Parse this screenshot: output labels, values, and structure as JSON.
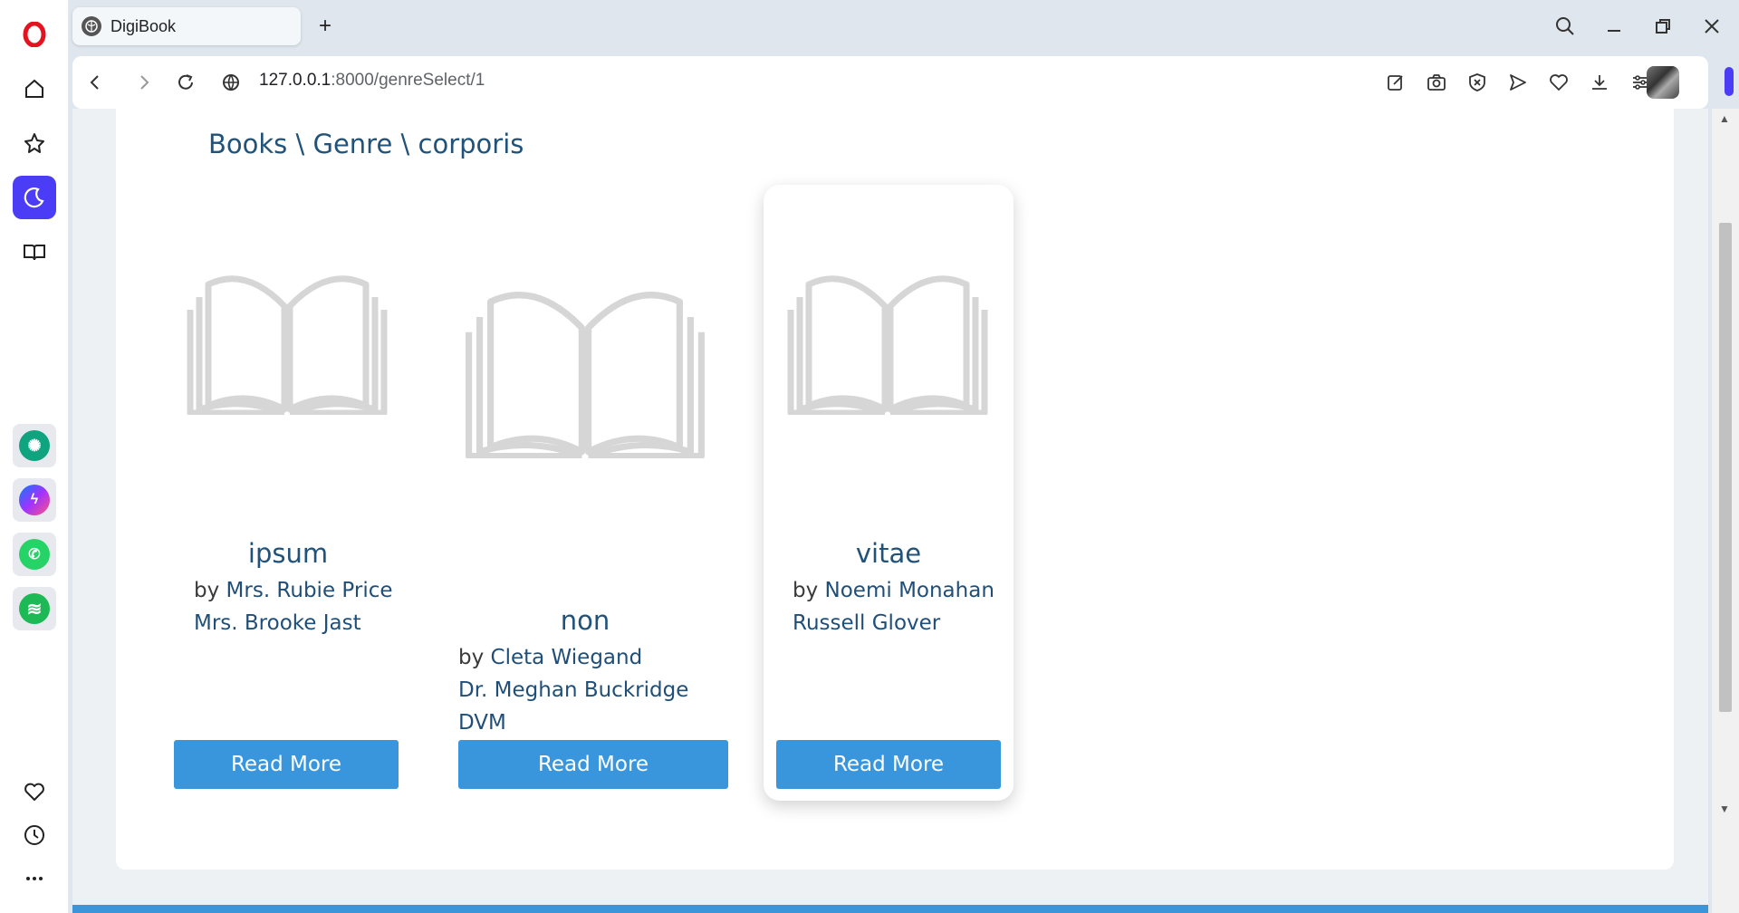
{
  "browser": {
    "tab_title": "DigiBook",
    "url_host": "127.0.0.1",
    "url_path": ":8000/genreSelect/1"
  },
  "page": {
    "breadcrumb": "Books \\ Genre \\ corporis",
    "books": [
      {
        "title": "ipsum",
        "by": "by",
        "authors": [
          "Mrs. Rubie Price",
          "Mrs. Brooke Jast"
        ],
        "button": "Read More"
      },
      {
        "title": "non",
        "by": "by",
        "authors": [
          "Cleta Wiegand",
          "Dr. Meghan Buckridge",
          "DVM"
        ],
        "button": "Read More"
      },
      {
        "title": "vitae",
        "by": "by",
        "authors": [
          "Noemi Monahan",
          "Russell Glover"
        ],
        "button": "Read More"
      }
    ]
  },
  "colors": {
    "accent": "#3a96dc",
    "heading": "#21527a",
    "opera_active": "#4b3cf5"
  }
}
